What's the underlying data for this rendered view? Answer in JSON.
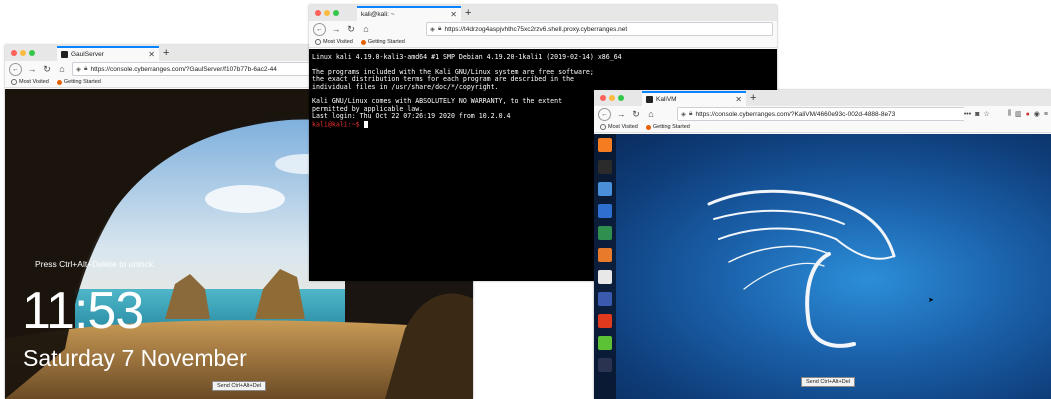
{
  "windows_server": {
    "tab_title": "GaulServer",
    "url": "https://console.cyberranges.com/?GaulServer/f107b77b-6ac2-44",
    "bookmarks": [
      "Most Visited",
      "Getting Started"
    ],
    "lock_hint": "Press Ctrl+Alt+Delete to unlock.",
    "time": "11:53",
    "date": "Saturday 7 November",
    "send_button": "Send Ctrl+Alt+Del"
  },
  "terminal": {
    "tab_title": "kali@kali: ~",
    "url": "https://t4drzog4aspjvhthc75xc2rzv6.shell.proxy.cyberranges.net",
    "bookmarks": [
      "Most Visited",
      "Getting Started"
    ],
    "lines": [
      "Linux kali 4.19.0-kali3-amd64 #1 SMP Debian 4.19.20-1kali1 (2019-02-14) x86_64",
      "",
      "The programs included with the Kali GNU/Linux system are free software;",
      "the exact distribution terms for each program are described in the",
      "individual files in /usr/share/doc/*/copyright.",
      "",
      "Kali GNU/Linux comes with ABSOLUTELY NO WARRANTY, to the extent",
      "permitted by applicable law.",
      "Last login: Thu Oct 22 07:26:19 2020 from 10.2.0.4"
    ],
    "prompt": "kali@kali:~$ "
  },
  "kali_vm": {
    "tab_title": "KaliVM",
    "url": "https://console.cyberranges.com/?KaliVM/4660e93c-002d-4888-8e73",
    "bookmarks": [
      "Most Visited",
      "Getting Started"
    ],
    "send_button": "Send Ctrl+Alt+Del",
    "dock_icons": [
      "firefox-icon",
      "terminal-icon",
      "files-icon",
      "maltego-icon",
      "metasploit-icon",
      "burpsuite-icon",
      "beef-icon",
      "armitage-icon",
      "faraday-icon",
      "leafpad-icon",
      "apps-grid-icon"
    ],
    "dock_colors": [
      "#f57c20",
      "#2b2b2b",
      "#4a90d9",
      "#2f6fd0",
      "#2f8f4f",
      "#e87a2c",
      "#e8e8e8",
      "#3a5ab0",
      "#e03a1e",
      "#5bc236",
      "#2a3350"
    ]
  },
  "colors": {
    "terminal_prompt": "#e8312c",
    "tab_accent": "#0a84ff"
  }
}
